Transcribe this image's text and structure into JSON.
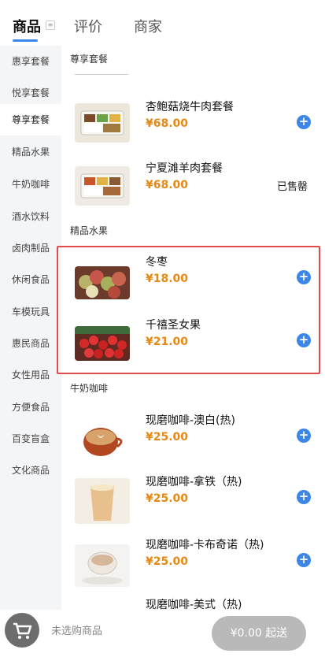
{
  "tabs": {
    "goods": "商品",
    "reviews": "评价",
    "merchant": "商家",
    "goods_badge": "≡"
  },
  "sidebar": {
    "items": [
      {
        "label": "惠享套餐"
      },
      {
        "label": "悦享套餐"
      },
      {
        "label": "尊享套餐"
      },
      {
        "label": "精品水果"
      },
      {
        "label": "牛奶咖啡"
      },
      {
        "label": "酒水饮料"
      },
      {
        "label": "卤肉制品"
      },
      {
        "label": "休闲食品"
      },
      {
        "label": "车模玩具"
      },
      {
        "label": "惠民商品"
      },
      {
        "label": "女性用品"
      },
      {
        "label": "方便食品"
      },
      {
        "label": "百变盲盒"
      },
      {
        "label": "文化商品"
      }
    ],
    "active_index": 2
  },
  "sections": [
    {
      "title": "尊享套餐",
      "items": [
        {
          "name": "杏鲍菇烧牛肉套餐",
          "price": "¥68.00",
          "status": ""
        },
        {
          "name": "宁夏滩羊肉套餐",
          "price": "¥68.00",
          "status": "已售罄"
        }
      ]
    },
    {
      "title": "精品水果",
      "items": [
        {
          "name": "冬枣",
          "price": "¥18.00"
        },
        {
          "name": "千禧圣女果",
          "price": "¥21.00"
        }
      ]
    },
    {
      "title": "牛奶咖啡",
      "items": [
        {
          "name": "现磨咖啡-澳白(热)",
          "price": "¥25.00"
        },
        {
          "name": "现磨咖啡-拿铁（热)",
          "price": "¥25.00"
        },
        {
          "name": "现磨咖啡-卡布奇诺（热)",
          "price": "¥25.00"
        },
        {
          "name": "现磨咖啡-美式（热)",
          "price": ""
        }
      ]
    }
  ],
  "add_symbol": "+",
  "bottom": {
    "cart_text": "未选购商品",
    "checkout": "¥0.00 起送"
  },
  "colors": {
    "accent": "#3b86e8",
    "price": "#e38a18",
    "highlight_border": "#e24b4b",
    "sidebar_bg": "#f4f5f7"
  }
}
